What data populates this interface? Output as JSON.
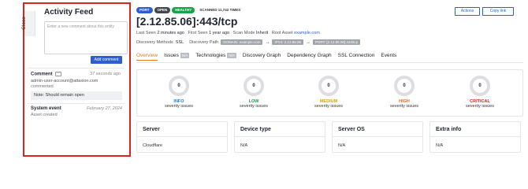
{
  "panel": {
    "close_label": "Close",
    "title": "Activity Feed",
    "comment_placeholder": "Enter a new comment about this entity",
    "add_comment_label": "Add comment",
    "comment": {
      "type": "Comment",
      "menu": "···",
      "time": "37 seconds ago",
      "user": "admin-user-account@attaxion.com",
      "action": "commented",
      "note": "Note: Should remain open"
    },
    "system_event": {
      "type": "System event",
      "date": "February 27, 2024",
      "detail": "Asset created"
    }
  },
  "header": {
    "badges": [
      "PORT",
      "OPEN",
      "HEALTHY",
      "SCANNED 11,742 TIMES"
    ],
    "title": "[2.12.85.06]:443/tcp",
    "actions_label": "Actions",
    "copy_link_label": "Copy link"
  },
  "meta": {
    "last_seen_label": "Last Seen",
    "last_seen": "2 minutes ago",
    "first_seen_label": "First Seen",
    "first_seen": "1 year ago",
    "scan_mode_label": "Scan Mode",
    "scan_mode": "Inherit",
    "root_asset_label": "Root Asset",
    "root_asset": "example.com",
    "discovery_methods_label": "Discovery Methods",
    "discovery_methods": "SSL",
    "discovery_path_label": "Discovery Path",
    "path": [
      "DOMAIN: example.com",
      "IPV4: 2.12.85.06",
      "PORT: [2.12.85.06]:443/tcp"
    ]
  },
  "tabs": [
    {
      "label": "Overview"
    },
    {
      "label": "Issues",
      "count": "N/A"
    },
    {
      "label": "Technologies",
      "count": "N/A"
    },
    {
      "label": "Discovery Graph"
    },
    {
      "label": "Dependency Graph"
    },
    {
      "label": "SSL Connection"
    },
    {
      "label": "Events"
    }
  ],
  "severities": [
    {
      "count": "0",
      "label": "INFO",
      "sub": "severity issues",
      "color": "#1f7ec4"
    },
    {
      "count": "0",
      "label": "LOW",
      "sub": "severity issues",
      "color": "#16a34a"
    },
    {
      "count": "0",
      "label": "MEDIUM",
      "sub": "severity issues",
      "color": "#e0a100"
    },
    {
      "count": "0",
      "label": "HIGH",
      "sub": "severity issues",
      "color": "#e26a1c"
    },
    {
      "count": "0",
      "label": "CRITICAL",
      "sub": "severity issues",
      "color": "#d9251c"
    }
  ],
  "info_cards": [
    {
      "title": "Server",
      "value": "Cloudflare"
    },
    {
      "title": "Device type",
      "value": "N/A"
    },
    {
      "title": "Server OS",
      "value": "N/A"
    },
    {
      "title": "Extra info",
      "value": "N/A"
    }
  ]
}
